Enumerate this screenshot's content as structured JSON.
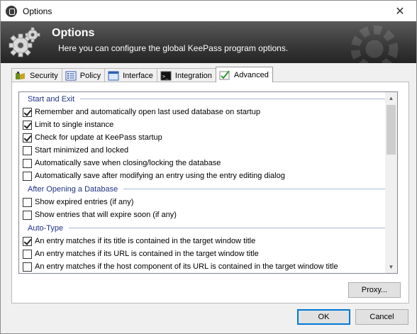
{
  "window": {
    "title": "Options",
    "close_glyph": "✕"
  },
  "banner": {
    "heading": "Options",
    "subheading": "Here you can configure the global KeePass program options.",
    "icon": "gears-icon"
  },
  "tabs": [
    {
      "label": "Security",
      "icon": "security-icon",
      "active": false
    },
    {
      "label": "Policy",
      "icon": "policy-icon",
      "active": false
    },
    {
      "label": "Interface",
      "icon": "interface-icon",
      "active": false
    },
    {
      "label": "Integration",
      "icon": "integration-icon",
      "active": false
    },
    {
      "label": "Advanced",
      "icon": "advanced-icon",
      "active": true
    }
  ],
  "advanced": {
    "groups": [
      {
        "header": "Start and Exit",
        "items": [
          {
            "label": "Remember and automatically open last used database on startup",
            "checked": true
          },
          {
            "label": "Limit to single instance",
            "checked": true
          },
          {
            "label": "Check for update at KeePass startup",
            "checked": true
          },
          {
            "label": "Start minimized and locked",
            "checked": false
          },
          {
            "label": "Automatically save when closing/locking the database",
            "checked": false
          },
          {
            "label": "Automatically save after modifying an entry using the entry editing dialog",
            "checked": false
          }
        ]
      },
      {
        "header": "After Opening a Database",
        "items": [
          {
            "label": "Show expired entries (if any)",
            "checked": false
          },
          {
            "label": "Show entries that will expire soon (if any)",
            "checked": false
          }
        ]
      },
      {
        "header": "Auto-Type",
        "items": [
          {
            "label": "An entry matches if its title is contained in the target window title",
            "checked": true
          },
          {
            "label": "An entry matches if its URL is contained in the target window title",
            "checked": false
          },
          {
            "label": "An entry matches if the host component of its URL is contained in the target window title",
            "checked": false
          }
        ]
      }
    ],
    "proxy_button": "Proxy..."
  },
  "footer": {
    "ok": "OK",
    "cancel": "Cancel"
  },
  "colors": {
    "group_header": "#1e3287",
    "banner_dark": "#242424",
    "default_button_border": "#0078d7"
  }
}
